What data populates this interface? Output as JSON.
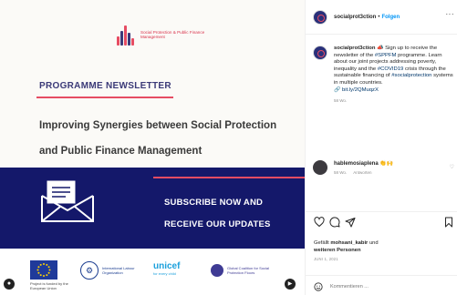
{
  "post": {
    "logo_text": "Social Protection & Public Finance Management",
    "newsletter_title": "PROGRAMME NEWSLETTER",
    "subtitle_line1": "Improving Synergies between Social Protection",
    "subtitle_line2": "and Public Finance Management",
    "subscribe_line1": "SUBSCRIBE NOW AND",
    "subscribe_line2": "RECEIVE OUR UPDATES",
    "partners": {
      "eu_caption": "Project is funded by the European Union",
      "ilo_text": "International Labour Organization",
      "unicef_main": "unicef",
      "unicef_sub": "for every child",
      "gcsp_text": "Global Coalition for Social Protection Floors"
    },
    "colors": {
      "band_blue": "#14186a",
      "accent_red": "#e64c63",
      "title_purple": "#3b3a78"
    }
  },
  "panel": {
    "header": {
      "username": "socialprot3ction",
      "separator": "•",
      "follow_label": "Folgen",
      "more_label": "···"
    },
    "caption": {
      "username": "socialprot3ction",
      "text_1": "Sign up to receive the newsletter of the",
      "hashtag_1": "#SPPFM",
      "text_2": "programme. Learn about our joint projects addressing poverty, inequality and the",
      "hashtag_2": "#COVID19",
      "text_3": "crisis through the sustainable financing of",
      "hashtag_3": "#socialprotection",
      "text_4": "systems in multiple countries.",
      "link": "bit.ly/2QMuqzX",
      "time": "58 Wo."
    },
    "comment": {
      "username": "hablemosiaplena",
      "text": "👏🙌",
      "time": "58 Wo.",
      "reply_label": "Antworten"
    },
    "likes": {
      "prefix": "Gefällt",
      "user": "mohsani_kabir",
      "middle": "und",
      "others": "weiteren Personen"
    },
    "date": "JUNI 1, 2021",
    "add_comment_placeholder": "Kommentieren ..."
  }
}
